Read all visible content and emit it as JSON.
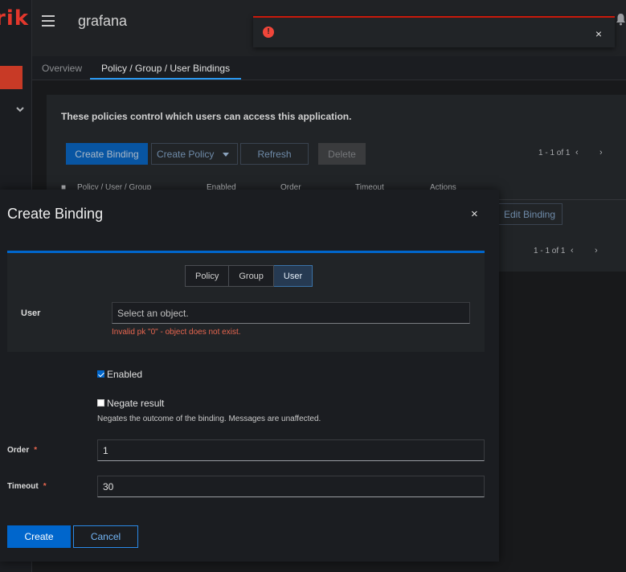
{
  "brand": {
    "text": "rik",
    "color": "#e3372c"
  },
  "header": {
    "title": "grafana"
  },
  "toast": {
    "icon": "exclamation-circle-icon",
    "message": "",
    "close_label": "×"
  },
  "tabs": [
    {
      "label": "Overview",
      "active": false
    },
    {
      "label": "Policy / Group / User Bindings",
      "active": true
    }
  ],
  "background": {
    "description": "These policies control which users can access this application.",
    "toolbar": {
      "create_binding": "Create Binding",
      "create_policy": "Create Policy",
      "refresh": "Refresh",
      "delete": "Delete"
    },
    "pagination": "1 - 1 of 1",
    "prev_label": "‹",
    "next_label": "›",
    "columns": [
      "Policy / User / Group",
      "Enabled",
      "Order",
      "Timeout",
      "Actions"
    ],
    "row_action": "Edit Binding"
  },
  "modal": {
    "title": "Create Binding",
    "close_label": "×",
    "toggles": [
      {
        "label": "Policy",
        "active": false
      },
      {
        "label": "Group",
        "active": false
      },
      {
        "label": "User",
        "active": true
      }
    ],
    "user_label": "User",
    "user_placeholder": "Select an object.",
    "user_error": "Invalid pk \"0\" - object does not exist.",
    "enabled_label": "Enabled",
    "enabled_checked": true,
    "negate_label": "Negate result",
    "negate_checked": false,
    "negate_help": "Negates the outcome of the binding. Messages are unaffected.",
    "order_label": "Order",
    "order_value": "1",
    "timeout_label": "Timeout",
    "timeout_value": "30",
    "required_mark": "*",
    "create_label": "Create",
    "cancel_label": "Cancel"
  },
  "colors": {
    "accent": "#0066cc",
    "danger": "#c9190b",
    "error_text": "#e8664f"
  }
}
